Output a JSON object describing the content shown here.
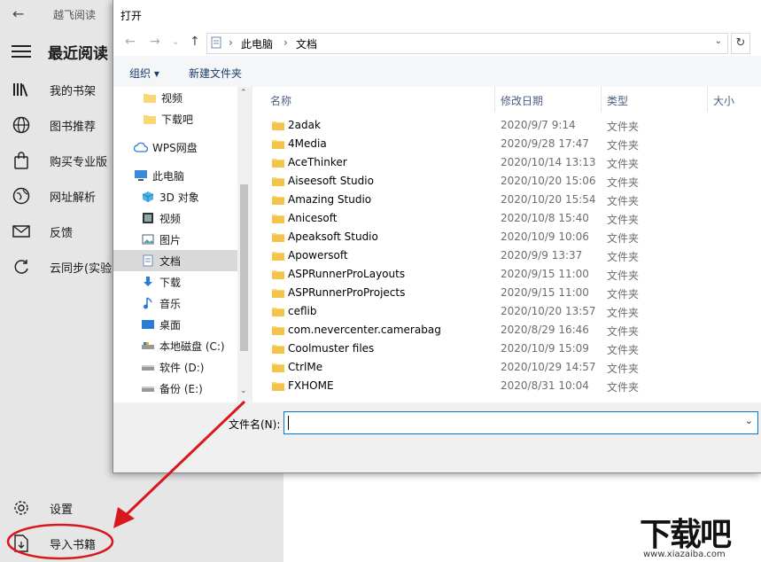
{
  "app": {
    "title": "越飞阅读",
    "menu_header": "最近阅读",
    "items": [
      {
        "label": "我的书架",
        "icon": "bookshelf-icon"
      },
      {
        "label": "图书推荐",
        "icon": "globe-icon"
      },
      {
        "label": "购买专业版",
        "icon": "shopping-bag-icon"
      },
      {
        "label": "网址解析",
        "icon": "web-icon"
      },
      {
        "label": "反馈",
        "icon": "mail-icon"
      },
      {
        "label": "云同步(实验",
        "icon": "sync-icon"
      }
    ],
    "settings_label": "设置",
    "import_label": "导入书籍"
  },
  "dialog": {
    "title": "打开",
    "breadcrumb": [
      "此电脑",
      "文档"
    ],
    "toolbar": {
      "organize": "组织 ▾",
      "new_folder": "新建文件夹"
    },
    "nav_items": [
      {
        "label": "视频",
        "icon": "folder-icon"
      },
      {
        "label": "下载吧",
        "icon": "folder-icon"
      },
      {
        "label": "WPS网盘",
        "icon": "cloud-icon"
      },
      {
        "label": "此电脑",
        "icon": "computer-icon"
      },
      {
        "label": "3D 对象",
        "icon": "cube-icon"
      },
      {
        "label": "视频",
        "icon": "video-icon"
      },
      {
        "label": "图片",
        "icon": "picture-icon"
      },
      {
        "label": "文档",
        "icon": "document-icon"
      },
      {
        "label": "下载",
        "icon": "download-icon"
      },
      {
        "label": "音乐",
        "icon": "music-icon"
      },
      {
        "label": "桌面",
        "icon": "desktop-icon"
      },
      {
        "label": "本地磁盘 (C:)",
        "icon": "drive-icon"
      },
      {
        "label": "软件 (D:)",
        "icon": "drive-icon"
      },
      {
        "label": "备份 (E:)",
        "icon": "drive-icon"
      }
    ],
    "columns": {
      "name": "名称",
      "date": "修改日期",
      "type": "类型",
      "size": "大小"
    },
    "files": [
      {
        "name": "2adak",
        "date": "2020/9/7 9:14",
        "type": "文件夹"
      },
      {
        "name": "4Media",
        "date": "2020/9/28 17:47",
        "type": "文件夹"
      },
      {
        "name": "AceThinker",
        "date": "2020/10/14 13:13",
        "type": "文件夹"
      },
      {
        "name": "Aiseesoft Studio",
        "date": "2020/10/20 15:06",
        "type": "文件夹"
      },
      {
        "name": "Amazing Studio",
        "date": "2020/10/20 15:54",
        "type": "文件夹"
      },
      {
        "name": "Anicesoft",
        "date": "2020/10/8 15:40",
        "type": "文件夹"
      },
      {
        "name": "Apeaksoft Studio",
        "date": "2020/10/9 10:06",
        "type": "文件夹"
      },
      {
        "name": "Apowersoft",
        "date": "2020/9/9 13:37",
        "type": "文件夹"
      },
      {
        "name": "ASPRunnerProLayouts",
        "date": "2020/9/15 11:00",
        "type": "文件夹"
      },
      {
        "name": "ASPRunnerProProjects",
        "date": "2020/9/15 11:00",
        "type": "文件夹"
      },
      {
        "name": "ceflib",
        "date": "2020/10/20 13:57",
        "type": "文件夹"
      },
      {
        "name": "com.nevercenter.camerabag",
        "date": "2020/8/29 16:46",
        "type": "文件夹"
      },
      {
        "name": "Coolmuster files",
        "date": "2020/10/9 15:09",
        "type": "文件夹"
      },
      {
        "name": "CtrlMe",
        "date": "2020/10/29 14:57",
        "type": "文件夹"
      },
      {
        "name": "FXHOME",
        "date": "2020/8/31 10:04",
        "type": "文件夹"
      }
    ],
    "filename_label": "文件名(N):",
    "filename_value": ""
  },
  "watermark": {
    "text": "下载吧",
    "url": "www.xiazaiba.com"
  },
  "colors": {
    "annotation": "#d9181e",
    "folder": "#f8d775",
    "accent": "#0078d7"
  }
}
